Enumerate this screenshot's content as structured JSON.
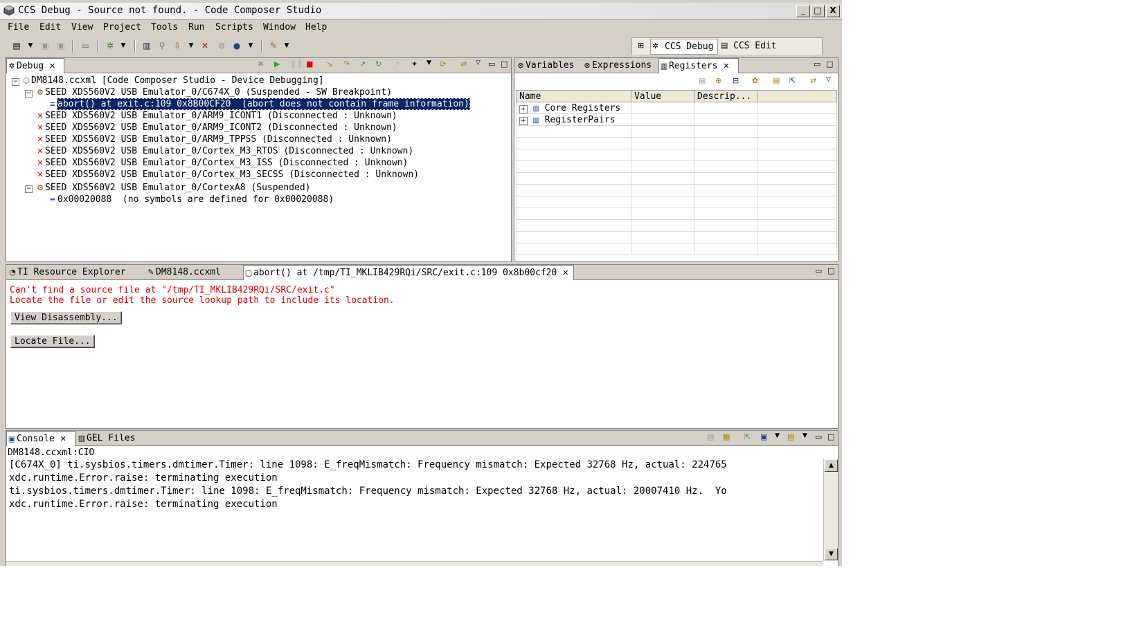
{
  "window": {
    "title": "CCS Debug - Source not found. - Code Composer Studio",
    "min": "_",
    "max": "□",
    "close": "X"
  },
  "menu": [
    "File",
    "Edit",
    "View",
    "Project",
    "Tools",
    "Run",
    "Scripts",
    "Window",
    "Help"
  ],
  "perspectives": {
    "debug": "CCS Debug",
    "edit": "CCS Edit"
  },
  "debug_view": {
    "tab": "Debug",
    "root": "DM8148.ccxml [Code Composer Studio - Device Debugging]",
    "rows": [
      "SEED XDS560V2 USB Emulator_0/C674X_0 (Suspended - SW Breakpoint)",
      "abort() at exit.c:109 0x8B00CF20  (abort does not contain frame information)",
      "SEED XDS560V2 USB Emulator_0/ARM9_ICONT1 (Disconnected : Unknown)",
      "SEED XDS560V2 USB Emulator_0/ARM9_ICONT2 (Disconnected : Unknown)",
      "SEED XDS560V2 USB Emulator_0/ARM9_TPPSS (Disconnected : Unknown)",
      "SEED XDS560V2 USB Emulator_0/Cortex_M3_RTOS (Disconnected : Unknown)",
      "SEED XDS560V2 USB Emulator_0/Cortex_M3_ISS (Disconnected : Unknown)",
      "SEED XDS560V2 USB Emulator_0/Cortex_M3_SECSS (Disconnected : Unknown)",
      "SEED XDS560V2 USB Emulator_0/CortexA8 (Suspended)",
      "0x00020088  (no symbols are defined for 0x00020088)"
    ]
  },
  "registers_view": {
    "tabs": [
      "Variables",
      "Expressions",
      "Registers"
    ],
    "columns": [
      "Name",
      "Value",
      "Descrip..."
    ],
    "rows": [
      "Core Registers",
      "RegisterPairs"
    ]
  },
  "editor": {
    "tabs": [
      "TI Resource Explorer",
      "DM8148.ccxml",
      "abort() at /tmp/TI_MKLIB429RQi/SRC/exit.c:109 0x8b00cf20"
    ],
    "msg1": "Can't find a source file at \"/tmp/TI_MKLIB429RQi/SRC/exit.c\"",
    "msg2": "Locate the file or edit the source lookup path to include its location.",
    "btn_disasm": "View Disassembly...",
    "btn_locate": "Locate File..."
  },
  "console": {
    "tabs": [
      "Console",
      "GEL Files"
    ],
    "header": "DM8148.ccxml:CIO",
    "lines": [
      "[C674X_0] ti.sysbios.timers.dmtimer.Timer: line 1098: E_freqMismatch: Frequency mismatch: Expected 32768 Hz, actual: 224765",
      "xdc.runtime.Error.raise: terminating execution",
      "ti.sysbios.timers.dmtimer.Timer: line 1098: E_freqMismatch: Frequency mismatch: Expected 32768 Hz, actual: 20007410 Hz.  Yo",
      "xdc.runtime.Error.raise: terminating execution"
    ]
  }
}
